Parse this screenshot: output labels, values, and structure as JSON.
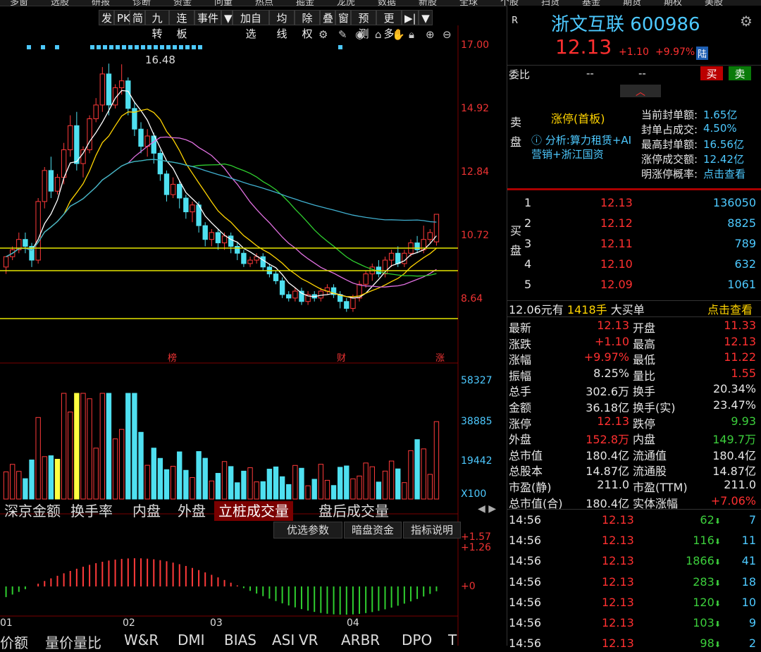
{
  "top_nav": [
    "多窗",
    "选股",
    "研报",
    "诊断",
    "资金",
    "问董",
    "热点",
    "掘金",
    "龙虎",
    "数据",
    "新股",
    "全球",
    "个股",
    "扫货",
    "基金",
    "期货",
    "期权",
    "美股"
  ],
  "toolbar": [
    "发",
    "PK",
    "简",
    "九转",
    "连板",
    "事件",
    "▼",
    "加自选",
    "均线",
    "除权",
    "叠",
    "窗",
    "预测",
    "更多",
    "▶|",
    "▼"
  ],
  "tool_icons": [
    "gear-icon",
    "pen-icon",
    "eye-icon",
    "lock-icon",
    "hand-icon",
    "lock2-icon",
    "zoom-in-icon",
    "zoom-out-icon"
  ],
  "price_axis": [
    "17.00",
    "14.92",
    "12.84",
    "10.72",
    "8.64"
  ],
  "high_label": "16.48",
  "vol_axis": [
    "58327",
    "38885",
    "19442",
    "X100"
  ],
  "macd_axis": [
    "+1.57",
    "+1.26",
    "+0"
  ],
  "date_axis": [
    "01",
    "02",
    "03",
    "04"
  ],
  "markers": [
    "榜",
    "财",
    "涨"
  ],
  "bottom_tabs": [
    "深京金额",
    "换手率",
    "内盘",
    "外盘",
    "立桩成交量",
    "盘后成交量"
  ],
  "indicator_buttons": [
    "优选参数",
    "暗盘资金",
    "指标说明"
  ],
  "indicator_tabs": [
    "价额",
    "量价量比",
    "W&R",
    "DMI",
    "BIAS",
    "ASI",
    "VR",
    "ARBR",
    "DPO",
    "T"
  ],
  "stock": {
    "market": "R",
    "name": "浙文互联",
    "code": "600986",
    "price": "12.13",
    "change": "+1.10",
    "change_pct": "+9.97%",
    "tag": "陆"
  },
  "weibi": {
    "label": "委比",
    "v1": "--",
    "v2": "--",
    "buy": "买",
    "sell": "卖"
  },
  "limit_info": {
    "side": "卖盘",
    "title": "涨停(首板)",
    "analysis": "分析:算力租赁+AI营销+浙江国资",
    "stats": [
      {
        "k": "当前封单额:",
        "v": "1.65亿"
      },
      {
        "k": "封单占成交:",
        "v": "4.50%"
      },
      {
        "k": "最高封单额:",
        "v": "16.56亿"
      },
      {
        "k": "涨停成交额:",
        "v": "12.42亿"
      },
      {
        "k": "明涨停概率:",
        "v": "点击查看"
      }
    ]
  },
  "buy_book": {
    "side": "买盘",
    "rows": [
      {
        "lvl": "1",
        "price": "12.13",
        "vol": "136050"
      },
      {
        "lvl": "2",
        "price": "12.12",
        "vol": "8825"
      },
      {
        "lvl": "3",
        "price": "12.11",
        "vol": "789"
      },
      {
        "lvl": "4",
        "price": "12.10",
        "vol": "632"
      },
      {
        "lvl": "5",
        "price": "12.09",
        "vol": "1061"
      }
    ]
  },
  "big_order": {
    "text1": "12.06元有",
    "text2": "1418手",
    "text3": "大买单",
    "link": "点击查看"
  },
  "quote": [
    {
      "k1": "最新",
      "v1": "12.13",
      "c1": "red",
      "k2": "开盘",
      "v2": "11.33",
      "c2": "red"
    },
    {
      "k1": "涨跌",
      "v1": "+1.10",
      "c1": "red",
      "k2": "最高",
      "v2": "12.13",
      "c2": "red"
    },
    {
      "k1": "涨幅",
      "v1": "+9.97%",
      "c1": "red",
      "k2": "最低",
      "v2": "11.22",
      "c2": "red"
    },
    {
      "k1": "振幅",
      "v1": "8.25%",
      "c1": "white",
      "k2": "量比",
      "v2": "1.55",
      "c2": "red"
    },
    {
      "k1": "总手",
      "v1": "302.6万",
      "c1": "white",
      "k2": "换手",
      "v2": "20.34%",
      "c2": "white"
    },
    {
      "k1": "金额",
      "v1": "36.18亿",
      "c1": "white",
      "k2": "换手(实)",
      "v2": "23.47%",
      "c2": "white"
    },
    {
      "k1": "涨停",
      "v1": "12.13",
      "c1": "red",
      "k2": "跌停",
      "v2": "9.93",
      "c2": "green"
    },
    {
      "k1": "外盘",
      "v1": "152.8万",
      "c1": "red",
      "k2": "内盘",
      "v2": "149.7万",
      "c2": "green"
    },
    {
      "k1": "总市值",
      "v1": "180.4亿",
      "c1": "white",
      "k2": "流通值",
      "v2": "180.4亿",
      "c2": "white"
    },
    {
      "k1": "总股本",
      "v1": "14.87亿",
      "c1": "white",
      "k2": "流通股",
      "v2": "14.87亿",
      "c2": "white"
    },
    {
      "k1": "市盈(静)",
      "v1": "211.0",
      "c1": "white",
      "k2": "市盈(TTM)",
      "v2": "211.0",
      "c2": "white"
    },
    {
      "k1": "总市值(合)",
      "v1": "180.4亿",
      "c1": "white",
      "k2": "实体涨幅",
      "v2": "+7.06%",
      "c2": "red"
    }
  ],
  "ticks": [
    {
      "t": "14:56",
      "p": "12.13",
      "v": "62",
      "n": "7"
    },
    {
      "t": "14:56",
      "p": "12.13",
      "v": "116",
      "n": "11"
    },
    {
      "t": "14:56",
      "p": "12.13",
      "v": "1866",
      "n": "41"
    },
    {
      "t": "14:56",
      "p": "12.13",
      "v": "283",
      "n": "18"
    },
    {
      "t": "14:56",
      "p": "12.13",
      "v": "120",
      "n": "10"
    },
    {
      "t": "14:56",
      "p": "12.13",
      "v": "103",
      "n": "9"
    },
    {
      "t": "14:56",
      "p": "12.13",
      "v": "98",
      "n": "2"
    }
  ],
  "candles": [
    [
      10.6,
      10.9,
      10.9,
      10.4
    ],
    [
      10.9,
      11.1,
      11.2,
      10.8
    ],
    [
      11.1,
      11.4,
      11.6,
      11.0
    ],
    [
      11.4,
      11.2,
      11.6,
      11.0
    ],
    [
      11.2,
      10.8,
      11.3,
      10.6
    ],
    [
      10.8,
      12.5,
      12.6,
      10.7
    ],
    [
      12.5,
      13.4,
      13.5,
      12.3
    ],
    [
      13.4,
      12.8,
      13.8,
      12.6
    ],
    [
      12.8,
      13.2,
      13.3,
      12.7
    ],
    [
      13.2,
      14.0,
      14.2,
      13.0
    ],
    [
      14.0,
      14.7,
      15.0,
      13.8
    ],
    [
      14.7,
      13.6,
      15.1,
      13.4
    ],
    [
      13.6,
      14.0,
      14.1,
      13.2
    ],
    [
      14.0,
      14.9,
      15.0,
      13.9
    ],
    [
      14.9,
      15.3,
      15.5,
      14.8
    ],
    [
      15.3,
      16.2,
      16.4,
      15.1
    ],
    [
      16.2,
      15.3,
      16.5,
      15.0
    ],
    [
      15.3,
      15.8,
      15.9,
      15.2
    ],
    [
      15.8,
      16.0,
      16.48,
      15.6
    ],
    [
      16.0,
      15.2,
      16.1,
      15.0
    ],
    [
      15.2,
      14.6,
      15.4,
      14.4
    ],
    [
      14.6,
      14.1,
      14.8,
      13.9
    ],
    [
      14.1,
      14.4,
      14.6,
      13.8
    ],
    [
      14.4,
      13.9,
      14.5,
      13.6
    ],
    [
      13.9,
      13.3,
      14.0,
      13.1
    ],
    [
      13.3,
      12.7,
      13.4,
      12.5
    ],
    [
      12.7,
      13.0,
      13.2,
      12.6
    ],
    [
      13.0,
      12.6,
      13.1,
      12.3
    ],
    [
      12.6,
      12.2,
      12.7,
      12.0
    ],
    [
      12.2,
      12.4,
      12.5,
      11.9
    ],
    [
      12.4,
      11.8,
      12.5,
      11.6
    ],
    [
      11.8,
      11.4,
      11.9,
      11.2
    ],
    [
      11.4,
      11.6,
      11.7,
      11.2
    ],
    [
      11.6,
      11.3,
      11.7,
      11.1
    ],
    [
      11.3,
      11.5,
      11.6,
      11.1
    ],
    [
      11.5,
      11.2,
      11.6,
      11.0
    ],
    [
      11.2,
      11.0,
      11.3,
      10.8
    ],
    [
      11.0,
      10.7,
      11.1,
      10.6
    ],
    [
      10.7,
      10.8,
      10.9,
      10.6
    ],
    [
      10.8,
      10.9,
      11.0,
      10.7
    ],
    [
      10.9,
      10.6,
      11.0,
      10.5
    ],
    [
      10.6,
      10.4,
      10.7,
      10.3
    ],
    [
      10.4,
      10.2,
      10.5,
      10.1
    ],
    [
      10.2,
      9.8,
      10.3,
      9.7
    ],
    [
      9.8,
      9.7,
      9.9,
      9.6
    ],
    [
      9.7,
      9.9,
      10.0,
      9.6
    ],
    [
      9.9,
      9.6,
      10.0,
      9.5
    ],
    [
      9.6,
      9.8,
      9.9,
      9.5
    ],
    [
      9.8,
      9.7,
      9.9,
      9.6
    ],
    [
      9.7,
      9.9,
      10.0,
      9.6
    ],
    [
      9.9,
      10.0,
      10.1,
      9.8
    ],
    [
      10.0,
      9.8,
      10.1,
      9.7
    ],
    [
      9.8,
      9.6,
      9.9,
      9.4
    ],
    [
      9.6,
      9.4,
      9.7,
      9.3
    ],
    [
      9.4,
      9.7,
      9.8,
      9.3
    ],
    [
      9.7,
      10.1,
      10.2,
      9.6
    ],
    [
      10.1,
      10.4,
      10.5,
      10.0
    ],
    [
      10.4,
      10.6,
      10.7,
      10.2
    ],
    [
      10.6,
      10.4,
      10.8,
      10.3
    ],
    [
      10.4,
      10.8,
      10.9,
      10.3
    ],
    [
      10.8,
      11.0,
      11.1,
      10.6
    ],
    [
      11.0,
      10.7,
      11.2,
      10.6
    ],
    [
      10.7,
      11.0,
      11.1,
      10.6
    ],
    [
      11.0,
      11.3,
      11.4,
      10.9
    ],
    [
      11.3,
      11.1,
      11.5,
      11.0
    ],
    [
      11.1,
      11.4,
      11.8,
      11.0
    ],
    [
      11.4,
      11.6,
      11.7,
      11.3
    ],
    [
      11.33,
      12.13,
      12.13,
      11.22
    ]
  ]
}
